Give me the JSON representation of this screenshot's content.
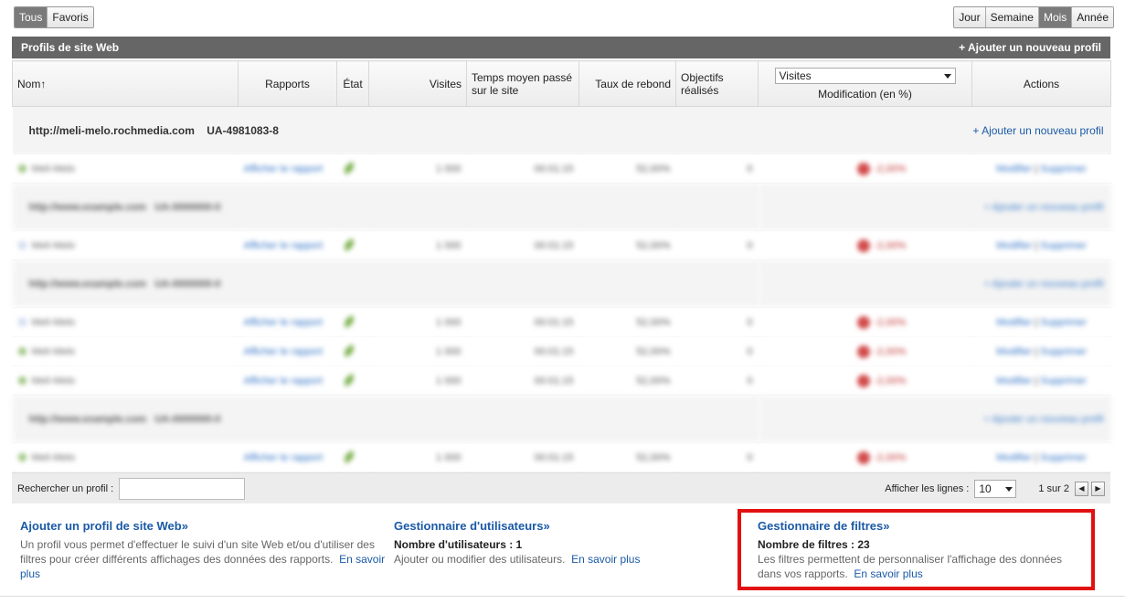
{
  "filters_left": [
    "Tous",
    "Favoris"
  ],
  "filters_right": [
    "Jour",
    "Semaine",
    "Mois",
    "Année"
  ],
  "panel": {
    "title": "Profils de site Web",
    "add_profile": "+ Ajouter un nouveau profil"
  },
  "columns": {
    "name": "Nom",
    "name_sort_icon": "↑",
    "reports": "Rapports",
    "state": "État",
    "visits": "Visites",
    "avg_time": "Temps moyen passé sur le site",
    "bounce": "Taux de rebond",
    "goals": "Objectifs réalisés",
    "metric_select": "Visites",
    "change": "Modification (en %)",
    "actions": "Actions"
  },
  "account": {
    "url": "http://meli-melo.rochmedia.com",
    "ua": "UA-4981083-8",
    "add_profile": "+ Ajouter un nouveau profil"
  },
  "blurred": {
    "profile_name": "Meli-Melo",
    "report_link": "Afficher le rapport",
    "visits": "1 000",
    "time": "00:01:15",
    "bounce": "52,00%",
    "goals": "0",
    "change": "-2,00%",
    "edit": "Modifier",
    "delete": "Supprimer",
    "account_url": "http://www.example.com",
    "account_ua": "UA-0000000-0",
    "account_add": "+ Ajouter un nouveau profil"
  },
  "bottom": {
    "search_label": "Rechercher un profil :",
    "rows_label": "Afficher les lignes :",
    "rows_value": "10",
    "page_info": "1 sur 2",
    "prev_icon": "◀",
    "next_icon": "▶"
  },
  "info": {
    "add_title": "Ajouter un profil de site Web»",
    "add_desc": "Un profil vous permet d'effectuer le suivi d'un site Web et/ou d'utiliser des filtres pour créer différents affichages des données des rapports.",
    "add_more": "En savoir plus",
    "users_title": "Gestionnaire d'utilisateurs»",
    "users_count": "Nombre d'utilisateurs : 1",
    "users_desc": "Ajouter ou modifier des utilisateurs.",
    "users_more": "En savoir plus",
    "filters_title": "Gestionnaire de filtres»",
    "filters_count": "Nombre de filtres : 23",
    "filters_desc": "Les filtres permettent de personnaliser l'affichage des données dans vos rapports.",
    "filters_more": "En savoir plus"
  }
}
